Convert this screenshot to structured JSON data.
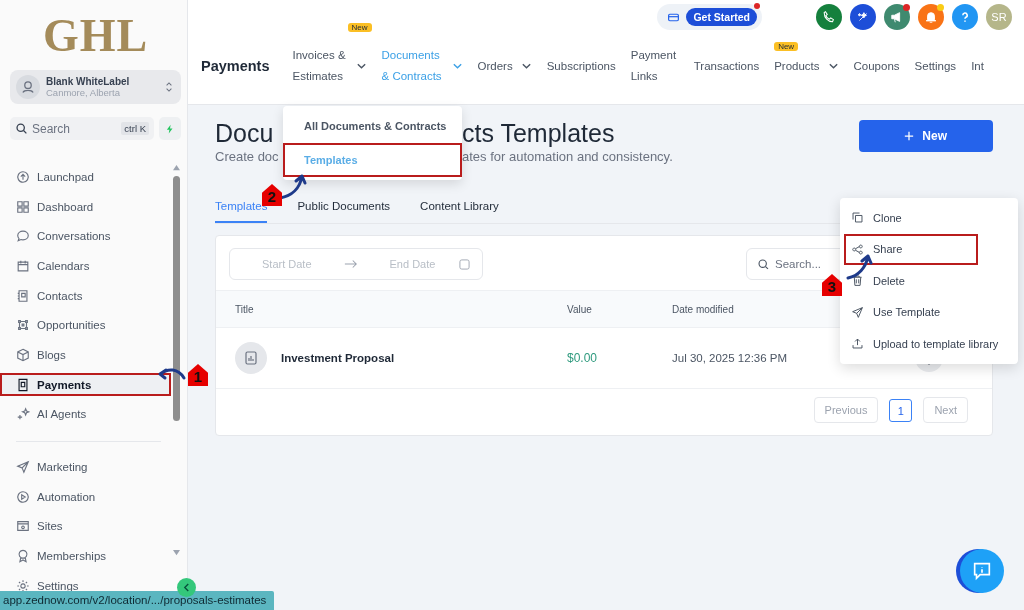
{
  "sidebar": {
    "logo": "GHL",
    "account": {
      "name": "Blank WhiteLabel",
      "location": "Canmore, Alberta"
    },
    "search": {
      "placeholder": "Search",
      "shortcut": "ctrl K"
    },
    "items": [
      {
        "label": "Launchpad",
        "selected": false,
        "highlighted": false
      },
      {
        "label": "Dashboard",
        "selected": false,
        "highlighted": false
      },
      {
        "label": "Conversations",
        "selected": false,
        "highlighted": false
      },
      {
        "label": "Calendars",
        "selected": false,
        "highlighted": false
      },
      {
        "label": "Contacts",
        "selected": false,
        "highlighted": false
      },
      {
        "label": "Opportunities",
        "selected": false,
        "highlighted": false
      },
      {
        "label": "Blogs",
        "selected": false,
        "highlighted": false
      },
      {
        "label": "Payments",
        "selected": true,
        "highlighted": true
      },
      {
        "label": "AI Agents",
        "selected": false,
        "highlighted": false
      }
    ],
    "items_lower": [
      {
        "label": "Marketing",
        "selected": false,
        "highlighted": false
      },
      {
        "label": "Automation",
        "selected": false,
        "highlighted": false
      },
      {
        "label": "Sites",
        "selected": false,
        "highlighted": false
      },
      {
        "label": "Memberships",
        "selected": false,
        "highlighted": false
      },
      {
        "label": "Settings",
        "selected": false,
        "highlighted": false
      }
    ]
  },
  "topbar": {
    "get_started": "Get Started",
    "avatar": "SR",
    "section_title": "Payments",
    "nav": [
      {
        "label": "Invoices & Estimates",
        "badge": "New",
        "dropdown": true,
        "selected": false
      },
      {
        "label": "Documents & Contracts",
        "dropdown": true,
        "selected": true
      },
      {
        "label": "Orders",
        "dropdown": true,
        "selected": false
      },
      {
        "label": "Subscriptions",
        "dropdown": false,
        "selected": false
      },
      {
        "label": "Payment Links",
        "dropdown": false,
        "selected": false
      },
      {
        "label": "Transactions",
        "dropdown": false,
        "selected": false
      },
      {
        "label": "Products",
        "badge": "New",
        "dropdown": true,
        "selected": false
      },
      {
        "label": "Coupons",
        "dropdown": false,
        "selected": false
      },
      {
        "label": "Settings",
        "dropdown": false,
        "selected": false
      },
      {
        "label": "Int",
        "dropdown": false,
        "selected": false
      }
    ]
  },
  "nav_menu": {
    "items": [
      {
        "label": "All Documents & Contracts",
        "selected": false,
        "highlighted": false
      },
      {
        "label": "Templates",
        "selected": true,
        "highlighted": true
      }
    ]
  },
  "page": {
    "title_start": "Docu",
    "title_end": "cts Templates",
    "subtitle_start": "Create doc",
    "subtitle_end": "ates for automation and consistency.",
    "new_button": "New",
    "tabs": [
      {
        "label": "Templates",
        "selected": true
      },
      {
        "label": "Public Documents",
        "selected": false
      },
      {
        "label": "Content Library",
        "selected": false
      }
    ],
    "filter": {
      "start": "Start Date",
      "end": "End Date"
    },
    "search_placeholder": "Search...",
    "table": {
      "columns": [
        "Title",
        "Value",
        "Date modified"
      ],
      "rows": [
        {
          "title": "Investment Proposal",
          "value": "$0.00",
          "date": "Jul 30, 2025 12:36 PM"
        }
      ]
    },
    "pagination": {
      "previous": "Previous",
      "pages": [
        {
          "label": "1",
          "selected": true
        }
      ],
      "next": "Next"
    }
  },
  "row_menu": {
    "items": [
      {
        "label": "Clone",
        "highlighted": false
      },
      {
        "label": "Share",
        "highlighted": true
      },
      {
        "label": "Delete",
        "highlighted": false
      },
      {
        "label": "Use Template",
        "highlighted": false
      },
      {
        "label": "Upload to template library",
        "highlighted": false
      }
    ]
  },
  "annotations": [
    "1",
    "2",
    "3"
  ],
  "status_bar": "app.zednow.com/v2/location/.../proposals-estimates"
}
